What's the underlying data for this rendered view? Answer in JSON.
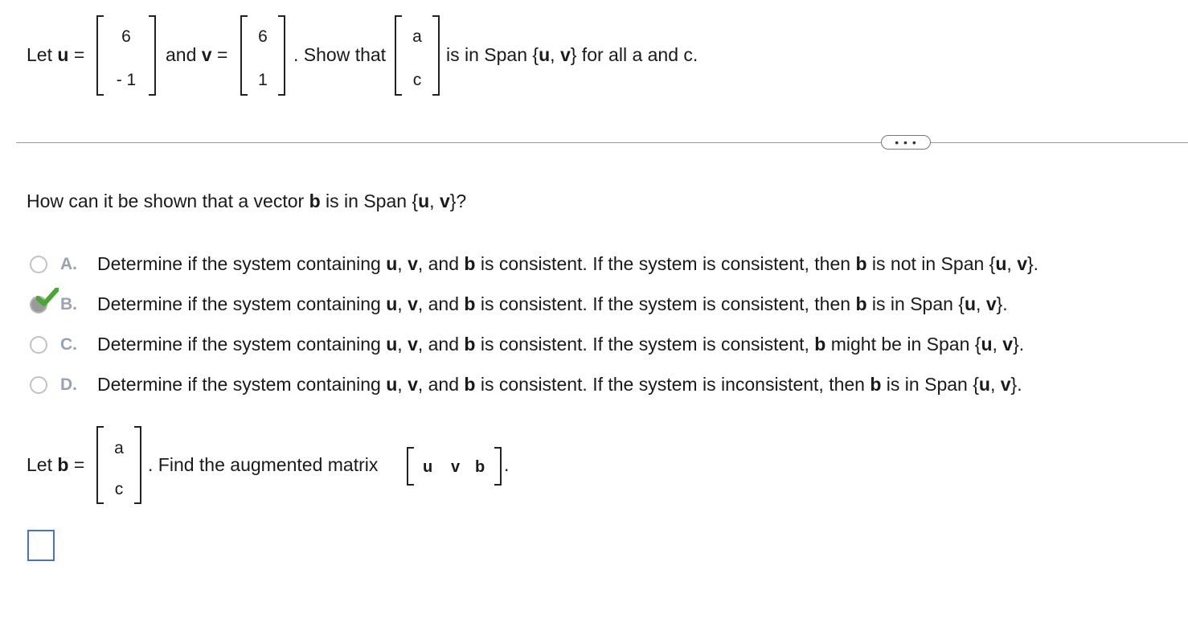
{
  "problem": {
    "let": "Let",
    "u_sym": "u",
    "eq": "=",
    "u_vec": [
      "6",
      "- 1"
    ],
    "and": "and",
    "v_sym": "v",
    "v_vec": [
      "6",
      "1"
    ],
    "show_that": ". Show that",
    "target_vec": [
      "a",
      "c"
    ],
    "tail_1": "is in Span {",
    "tail_u": "u",
    "tail_comma": ", ",
    "tail_v": "v",
    "tail_2": "} for all a and c."
  },
  "more_button": "• • •",
  "question": {
    "pre": "How can it be shown that a vector ",
    "b": "b",
    "mid": " is in Span {",
    "u": "u",
    "comma": ", ",
    "v": "v",
    "post": "}?"
  },
  "options": [
    {
      "letter": "A.",
      "p1": "Determine if the system containing ",
      "u": "u",
      "c1": ", ",
      "v": "v",
      "c2": ", and ",
      "b": "b",
      "p2": " is consistent. If the system is consistent, then ",
      "b2": "b",
      "p3": " is not in Span {",
      "u2": "u",
      "c3": ", ",
      "v2": "v",
      "p4": "}.",
      "selected": false
    },
    {
      "letter": "B.",
      "p1": "Determine if the system containing ",
      "u": "u",
      "c1": ", ",
      "v": "v",
      "c2": ", and ",
      "b": "b",
      "p2": " is consistent. If the system is consistent, then ",
      "b2": "b",
      "p3": " is in Span {",
      "u2": "u",
      "c3": ", ",
      "v2": "v",
      "p4": "}.",
      "selected": true
    },
    {
      "letter": "C.",
      "p1": "Determine if the system containing ",
      "u": "u",
      "c1": ", ",
      "v": "v",
      "c2": ", and ",
      "b": "b",
      "p2": " is consistent. If the system is consistent, ",
      "b2": "b",
      "p3": " might be in Span {",
      "u2": "u",
      "c3": ", ",
      "v2": "v",
      "p4": "}.",
      "selected": false
    },
    {
      "letter": "D.",
      "p1": "Determine if the system containing ",
      "u": "u",
      "c1": ", ",
      "v": "v",
      "c2": ", and ",
      "b": "b",
      "p2": " is consistent. If the system is inconsistent, then ",
      "b2": "b",
      "p3": " is in Span {",
      "u2": "u",
      "c3": ", ",
      "v2": "v",
      "p4": "}.",
      "selected": false
    }
  ],
  "part2": {
    "let": "Let",
    "b_sym": "b",
    "eq": "=",
    "b_vec": [
      "a",
      "c"
    ],
    "find": ". Find the augmented matrix",
    "aug": [
      "u",
      "v",
      "b"
    ],
    "end": "."
  },
  "colors": {
    "accent_check": "#4aa832",
    "answer_border": "#4a72c8",
    "letter_gray": "#9aa2ad"
  }
}
